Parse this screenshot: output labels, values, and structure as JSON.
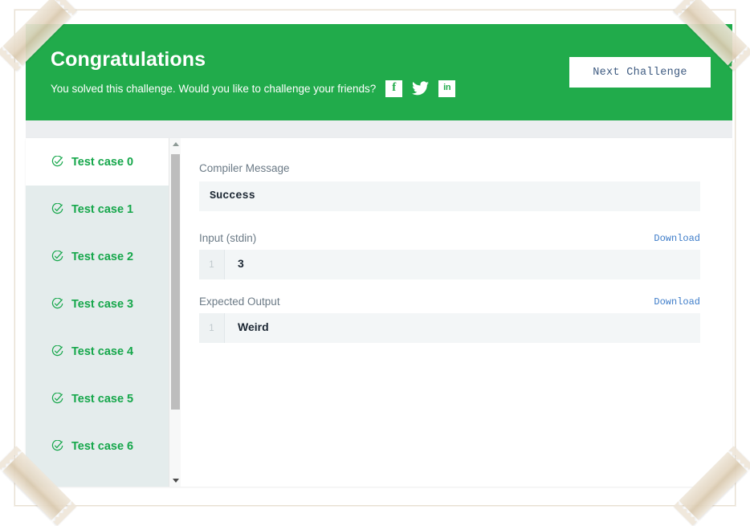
{
  "header": {
    "title": "Congratulations",
    "subtitle": "You solved this challenge. Would you like to challenge your friends?",
    "next_button_label": "Next Challenge",
    "accent_color": "#21ab4b",
    "social": [
      {
        "name": "facebook-icon",
        "glyph": "f"
      },
      {
        "name": "twitter-icon",
        "glyph": ""
      },
      {
        "name": "linkedin-icon",
        "glyph": "in"
      }
    ]
  },
  "sidebar": {
    "items": [
      {
        "label": "Test case 0",
        "status": "passed",
        "selected": true
      },
      {
        "label": "Test case 1",
        "status": "passed",
        "selected": false
      },
      {
        "label": "Test case 2",
        "status": "passed",
        "selected": false
      },
      {
        "label": "Test case 3",
        "status": "passed",
        "selected": false
      },
      {
        "label": "Test case 4",
        "status": "passed",
        "selected": false
      },
      {
        "label": "Test case 5",
        "status": "passed",
        "selected": false
      },
      {
        "label": "Test case 6",
        "status": "passed",
        "selected": false
      }
    ],
    "status_icon": "check-circle-icon",
    "scrollbar": {
      "up_arrow": "chevron-up-icon",
      "down_arrow": "chevron-down-icon"
    }
  },
  "detail": {
    "compiler": {
      "label": "Compiler Message",
      "value": "Success"
    },
    "input": {
      "label": "Input (stdin)",
      "download_label": "Download",
      "lines": [
        {
          "number": "1",
          "text": "3"
        }
      ]
    },
    "expected": {
      "label": "Expected Output",
      "download_label": "Download",
      "lines": [
        {
          "number": "1",
          "text": "Weird"
        }
      ]
    }
  }
}
